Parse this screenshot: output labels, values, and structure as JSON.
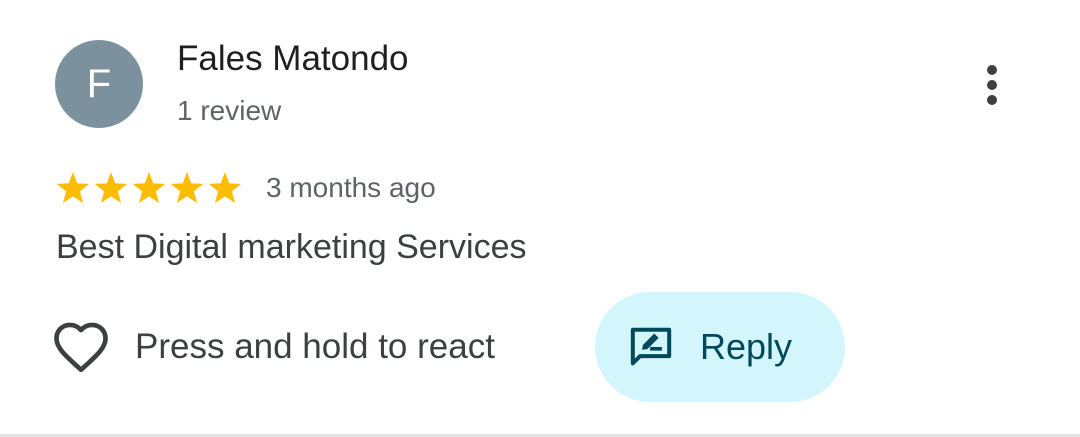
{
  "reviewer": {
    "avatar_initial": "F",
    "avatar_color": "#7b919e",
    "name": "Fales Matondo",
    "subtitle": "1 review"
  },
  "rating": {
    "stars": 5,
    "max_stars": 5,
    "star_color": "#fbbc04",
    "timestamp": "3 months ago"
  },
  "review": {
    "text": "Best Digital marketing Services"
  },
  "actions": {
    "react_label": "Press and hold to react",
    "react_icon": "heart-outline-icon",
    "reply_label": "Reply",
    "reply_icon": "rate-review-icon",
    "reply_bg_color": "#d3f5fc",
    "reply_text_color": "#004a59",
    "more_icon": "more-vert-icon"
  }
}
